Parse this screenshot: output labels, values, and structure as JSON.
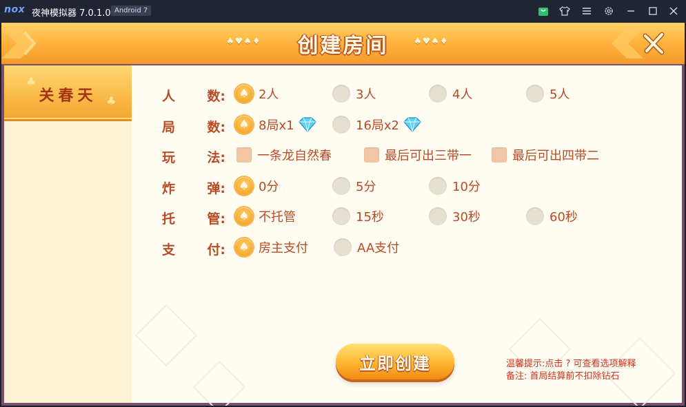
{
  "titlebar": {
    "logo": "nox",
    "title": "夜神模拟器 7.0.1.0",
    "badge": "Android 7",
    "icons": [
      "bag-icon",
      "shirt-icon",
      "menu-icon",
      "gear-icon",
      "minimize-icon",
      "maximize-icon",
      "close-icon"
    ]
  },
  "header": {
    "title": "创建房间",
    "suits": "♠♥♠♦"
  },
  "sidebar": {
    "tabs": [
      {
        "label": "关春天",
        "active": true
      }
    ]
  },
  "form": {
    "rows": [
      {
        "label": [
          "人",
          "数:"
        ],
        "type": "radio",
        "options": [
          "2人",
          "3人",
          "4人",
          "5人"
        ],
        "selected": 0
      },
      {
        "label": [
          "局",
          "数:"
        ],
        "type": "radio",
        "options": [
          "8局x1",
          "16局x2"
        ],
        "selected": 0,
        "gem_icon": "diamond-icon"
      },
      {
        "label": [
          "玩",
          "法:"
        ],
        "type": "checkbox",
        "options": [
          "一条龙自然春",
          "最后可出三带一",
          "最后可出四带二"
        ],
        "checked": []
      },
      {
        "label": [
          "炸",
          "弹:"
        ],
        "type": "radio",
        "options": [
          "0分",
          "5分",
          "10分"
        ],
        "selected": 0
      },
      {
        "label": [
          "托",
          "管:"
        ],
        "type": "radio",
        "options": [
          "不托管",
          "15秒",
          "30秒",
          "60秒"
        ],
        "selected": 0
      },
      {
        "label": [
          "支",
          "付:"
        ],
        "type": "radio",
        "options": [
          "房主支付",
          "AA支付"
        ],
        "selected": 0
      }
    ]
  },
  "create_button": "立即创建",
  "tips": {
    "line1": "温馨提示:点击 ? 可查看选项解释",
    "line2": "备注: 首局结算前不扣除钻石"
  },
  "colors": {
    "accent": "#f5a52c",
    "label": "#b84a25",
    "tip": "#d0321e"
  }
}
